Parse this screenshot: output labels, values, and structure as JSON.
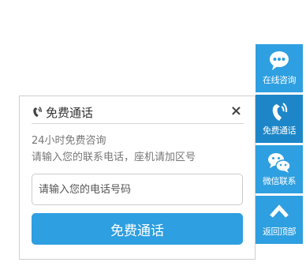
{
  "toolbar": {
    "items": [
      {
        "label": "在线咨询",
        "icon": "chat-bubble-icon"
      },
      {
        "label": "免费通话",
        "icon": "phone-icon"
      },
      {
        "label": "微信联系",
        "icon": "wechat-icon"
      },
      {
        "label": "返回顶部",
        "icon": "chevron-up-icon"
      }
    ]
  },
  "popup": {
    "title": "免费通话",
    "close": "×",
    "desc1": "24小时免费咨询",
    "desc2": "请输入您的联系电话，座机请加区号",
    "input_placeholder": "请输入您的电话号码",
    "button_label": "免费通话"
  },
  "colors": {
    "accent": "#2e9fe0",
    "accent_active": "#1d86c8"
  }
}
